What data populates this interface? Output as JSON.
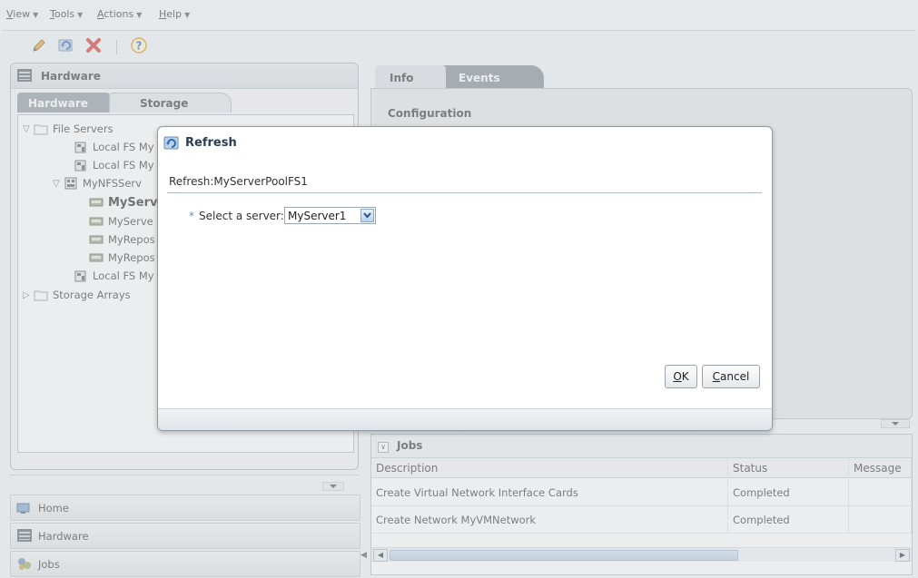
{
  "menubar": {
    "items": [
      {
        "label": "View",
        "mnemonic": "V",
        "rest": "iew"
      },
      {
        "label": "Tools",
        "mnemonic": "T",
        "rest": "ools"
      },
      {
        "label": "Actions",
        "mnemonic": "A",
        "rest": "ctions"
      },
      {
        "label": "Help",
        "mnemonic": "H",
        "rest": "elp"
      }
    ]
  },
  "toolbar": {
    "icons": [
      "edit-icon",
      "refresh-icon",
      "delete-icon",
      "help-icon"
    ]
  },
  "left_panel": {
    "title": "Hardware",
    "tabs": [
      {
        "label": "Hardware"
      },
      {
        "label": "Storage"
      }
    ],
    "tree": [
      {
        "label": "File Servers",
        "icon": "folder-icon",
        "twisty": "▽"
      },
      {
        "label": "Local FS My",
        "icon": "local-fs-icon"
      },
      {
        "label": "Local FS My",
        "icon": "local-fs-icon"
      },
      {
        "label": "MyNFSServ",
        "icon": "nfs-server-icon",
        "twisty": "▽"
      },
      {
        "label": "MyServ",
        "icon": "file-system-icon",
        "bold": true
      },
      {
        "label": "MyServe",
        "icon": "file-system-icon"
      },
      {
        "label": "MyRepos",
        "icon": "file-system-icon"
      },
      {
        "label": "MyRepos",
        "icon": "file-system-icon"
      },
      {
        "label": "Local FS My",
        "icon": "local-fs-icon"
      },
      {
        "label": "Storage Arrays",
        "icon": "folder-icon",
        "twisty": "▷"
      }
    ]
  },
  "nav": {
    "items": [
      {
        "label": "Home",
        "icon": "home-icon"
      },
      {
        "label": "Hardware",
        "icon": "hardware-icon"
      },
      {
        "label": "Jobs",
        "icon": "jobs-icon"
      }
    ]
  },
  "right_panel": {
    "tabs": [
      {
        "label": "Info"
      },
      {
        "label": "Events"
      }
    ],
    "section_label": "Configuration"
  },
  "jobs": {
    "title": "Jobs",
    "columns": [
      "Description",
      "Status",
      "Message"
    ],
    "rows": [
      {
        "description": "Create Virtual Network Interface Cards",
        "status": "Completed",
        "message": ""
      },
      {
        "description": "Create Network MyVMNetwork",
        "status": "Completed",
        "message": ""
      }
    ]
  },
  "dialog": {
    "title": "Refresh",
    "subtitle": "Refresh:MyServerPoolFS1",
    "required_marker": "*",
    "field_label": "Select a server:",
    "server_value": "MyServer1",
    "ok": {
      "mnemonic": "O",
      "rest": "K"
    },
    "cancel": {
      "mnemonic": "C",
      "rest": "ancel"
    }
  },
  "colors": {
    "accent": "#2a3d52",
    "tab_active_dark": "#828b93",
    "panel_bg": "#e5e8eb"
  }
}
